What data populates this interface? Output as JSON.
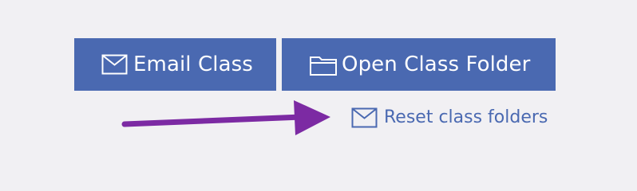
{
  "actions": {
    "email_class": {
      "label": "Email Class",
      "icon": "envelope-icon"
    },
    "open_class_folder": {
      "label": "Open Class Folder",
      "icon": "folder-icon"
    },
    "reset_class_folders": {
      "label": "Reset class folders",
      "icon": "envelope-icon"
    }
  },
  "annotation": {
    "icon": "arrow-right-icon"
  },
  "colors": {
    "background": "#f1f0f3",
    "button": "#4a69b1",
    "link": "#4a69b1",
    "arrow": "#7c2aa3"
  }
}
